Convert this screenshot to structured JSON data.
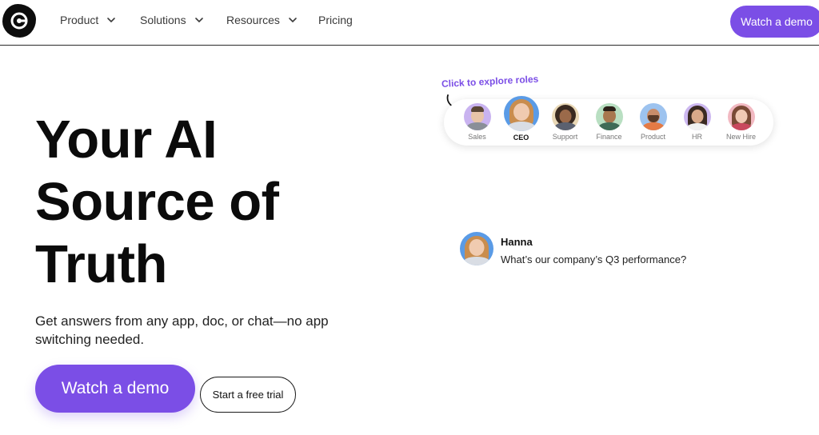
{
  "nav": {
    "items": [
      {
        "label": "Product",
        "has_dropdown": true
      },
      {
        "label": "Solutions",
        "has_dropdown": true
      },
      {
        "label": "Resources",
        "has_dropdown": true
      },
      {
        "label": "Pricing",
        "has_dropdown": false
      }
    ],
    "cta_label": "Watch a demo",
    "icons": {
      "logo": "glean-logo",
      "dropdown": "chevron-down-icon"
    }
  },
  "hero": {
    "title_line1": "Your AI",
    "title_line2": "Source of",
    "title_line3": "Truth",
    "subtitle": "Get answers from any app, doc, or chat—no app switching needed.",
    "primary_cta": "Watch a demo",
    "secondary_cta": "Start a free trial"
  },
  "roles": {
    "hint": "Click to explore roles",
    "selected": "CEO",
    "items": [
      {
        "label": "Sales",
        "ring": "#c9b3f0"
      },
      {
        "label": "CEO",
        "ring": "#5a9be6"
      },
      {
        "label": "Support",
        "ring": "#e9d8b6"
      },
      {
        "label": "Finance",
        "ring": "#b9dfc2"
      },
      {
        "label": "Product",
        "ring": "#9dc3ef"
      },
      {
        "label": "HR",
        "ring": "#cdb8f0"
      },
      {
        "label": "New Hire",
        "ring": "#f2b9c2"
      }
    ]
  },
  "chat": {
    "name": "Hanna",
    "message": "What’s our company’s Q3 performance?"
  },
  "colors": {
    "brand": "#7b4ee6",
    "text": "#111111",
    "border": "#2a2a2a"
  }
}
